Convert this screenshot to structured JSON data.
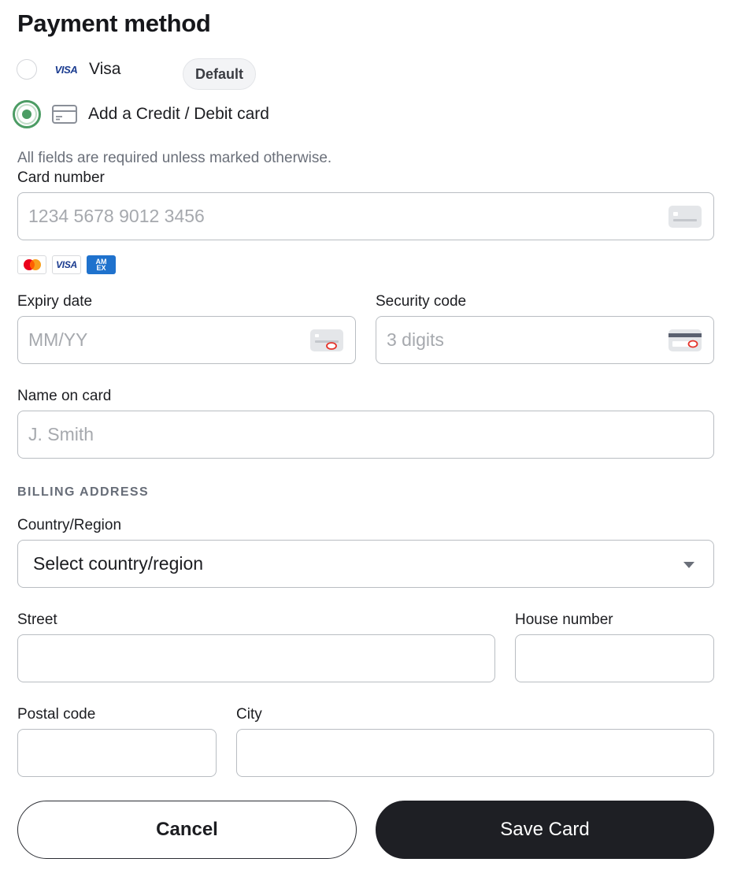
{
  "page": {
    "title": "Payment method"
  },
  "payment_methods": [
    {
      "label": "Visa",
      "badge": "Default",
      "brand_text": "VISA",
      "selected": false,
      "icon": "visa-logo-icon"
    },
    {
      "label": "Add a Credit / Debit card",
      "selected": true,
      "icon": "credit-card-icon"
    }
  ],
  "form": {
    "hint": "All fields are required unless marked otherwise.",
    "card_number": {
      "label": "Card number",
      "placeholder": "1234 5678 9012 3456",
      "icon": "card-number-icon"
    },
    "accepted_brands": [
      {
        "name": "mastercard-icon"
      },
      {
        "name": "visa-icon",
        "text": "VISA"
      },
      {
        "name": "amex-icon",
        "text_top": "AM",
        "text_bottom": "EX"
      }
    ],
    "expiry": {
      "label": "Expiry date",
      "placeholder": "MM/YY",
      "icon": "card-expiry-icon"
    },
    "security": {
      "label": "Security code",
      "placeholder": "3 digits",
      "icon": "card-cvc-icon"
    },
    "name": {
      "label": "Name on card",
      "placeholder": "J. Smith"
    }
  },
  "billing": {
    "section_label": "BILLING ADDRESS",
    "country": {
      "label": "Country/Region",
      "value": "Select country/region"
    },
    "street": {
      "label": "Street",
      "value": ""
    },
    "house_number": {
      "label": "House number",
      "value": ""
    },
    "postal_code": {
      "label": "Postal code",
      "value": ""
    },
    "city": {
      "label": "City",
      "value": ""
    }
  },
  "actions": {
    "cancel_label": "Cancel",
    "save_label": "Save Card"
  },
  "colors": {
    "accent_green": "#4c9c64",
    "primary_dark": "#1e1f24",
    "border": "#b9bdc2",
    "placeholder": "#a6a9ae"
  }
}
